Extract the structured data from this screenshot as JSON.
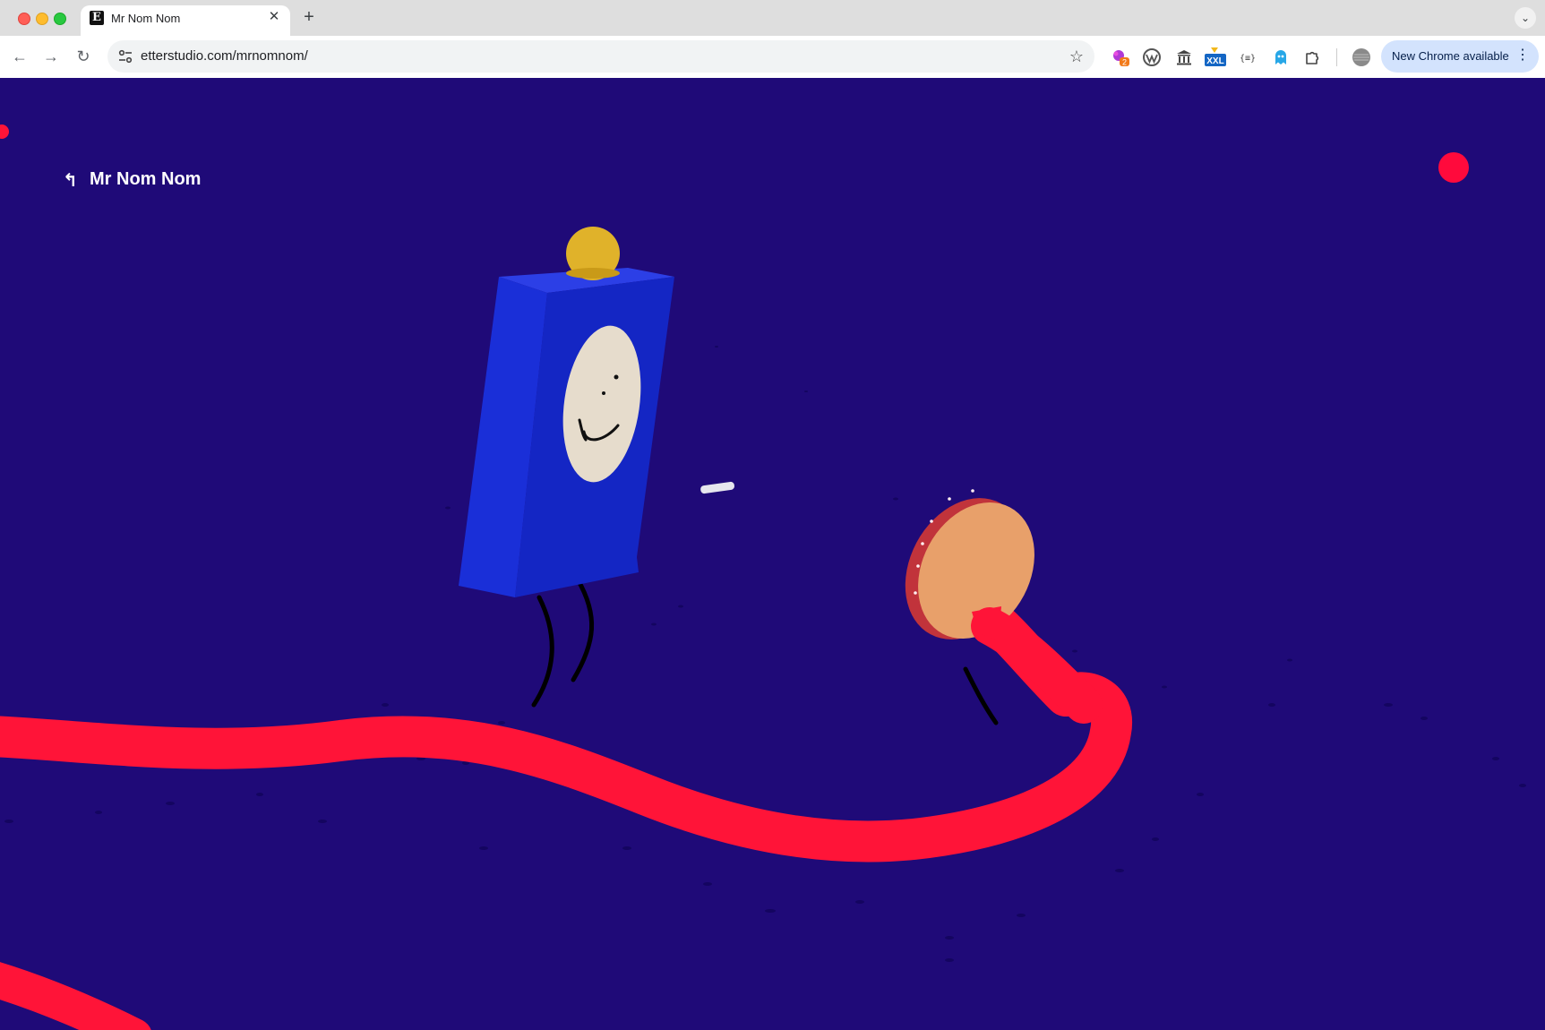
{
  "browser": {
    "tab": {
      "title": "Mr Nom Nom",
      "favicon_letter": "E"
    },
    "url": "etterstudio.com/mrnomnom/",
    "update_button": "New Chrome available",
    "extension_badge_count": "2",
    "extension_xxl_label": "XXL",
    "extension_json_label": "{≡}",
    "icons": [
      "back-icon",
      "forward-icon",
      "reload-icon",
      "site-info-icon",
      "bookmark-star-icon",
      "puzzle-extensions-icon",
      "profile-avatar-icon",
      "kebab-menu-icon"
    ]
  },
  "page": {
    "back_arrow": "↰",
    "title": "Mr Nom Nom",
    "colors": {
      "background": "#1f0a78",
      "accent_red": "#ff0a3c",
      "character_blue": "#1a2fd8",
      "coin_gold": "#e0b22a",
      "cookie": "#e8a06a"
    }
  }
}
